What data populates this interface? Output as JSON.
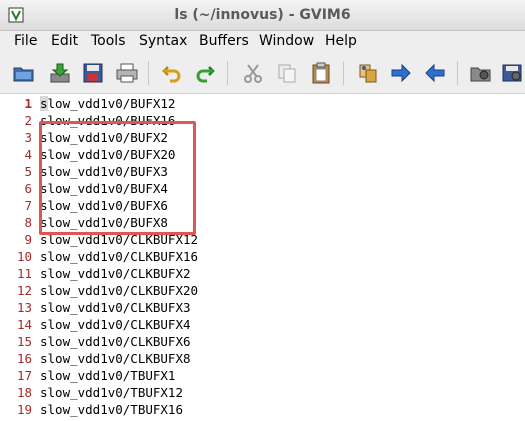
{
  "window": {
    "title": "ls (~/innovus) - GVIM6"
  },
  "menu": [
    "File",
    "Edit",
    "Tools",
    "Syntax",
    "Buffers",
    "Window",
    "Help"
  ],
  "toolbar": {
    "icons": [
      "open-icon",
      "save-down-icon",
      "save-icon",
      "print-icon",
      "undo-icon",
      "redo-icon",
      "cut-icon",
      "copy-icon",
      "paste-icon",
      "replace-icon",
      "forward-icon",
      "back-icon",
      "make-icon",
      "script-icon"
    ]
  },
  "editor": {
    "lines": [
      {
        "n": "1",
        "t": "slow_vdd1v0/BUFX12"
      },
      {
        "n": "2",
        "t": "slow_vdd1v0/BUFX16"
      },
      {
        "n": "3",
        "t": "slow_vdd1v0/BUFX2"
      },
      {
        "n": "4",
        "t": "slow_vdd1v0/BUFX20"
      },
      {
        "n": "5",
        "t": "slow_vdd1v0/BUFX3"
      },
      {
        "n": "6",
        "t": "slow_vdd1v0/BUFX4"
      },
      {
        "n": "7",
        "t": "slow_vdd1v0/BUFX6"
      },
      {
        "n": "8",
        "t": "slow_vdd1v0/BUFX8"
      },
      {
        "n": "9",
        "t": "slow_vdd1v0/CLKBUFX12"
      },
      {
        "n": "10",
        "t": "slow_vdd1v0/CLKBUFX16"
      },
      {
        "n": "11",
        "t": "slow_vdd1v0/CLKBUFX2"
      },
      {
        "n": "12",
        "t": "slow_vdd1v0/CLKBUFX20"
      },
      {
        "n": "13",
        "t": "slow_vdd1v0/CLKBUFX3"
      },
      {
        "n": "14",
        "t": "slow_vdd1v0/CLKBUFX4"
      },
      {
        "n": "15",
        "t": "slow_vdd1v0/CLKBUFX6"
      },
      {
        "n": "16",
        "t": "slow_vdd1v0/CLKBUFX8"
      },
      {
        "n": "17",
        "t": "slow_vdd1v0/TBUFX1"
      },
      {
        "n": "18",
        "t": "slow_vdd1v0/TBUFX12"
      },
      {
        "n": "19",
        "t": "slow_vdd1v0/TBUFX16"
      }
    ]
  },
  "colors": {
    "line_number": "#a52a2a",
    "highlight_box": "#e05555"
  }
}
